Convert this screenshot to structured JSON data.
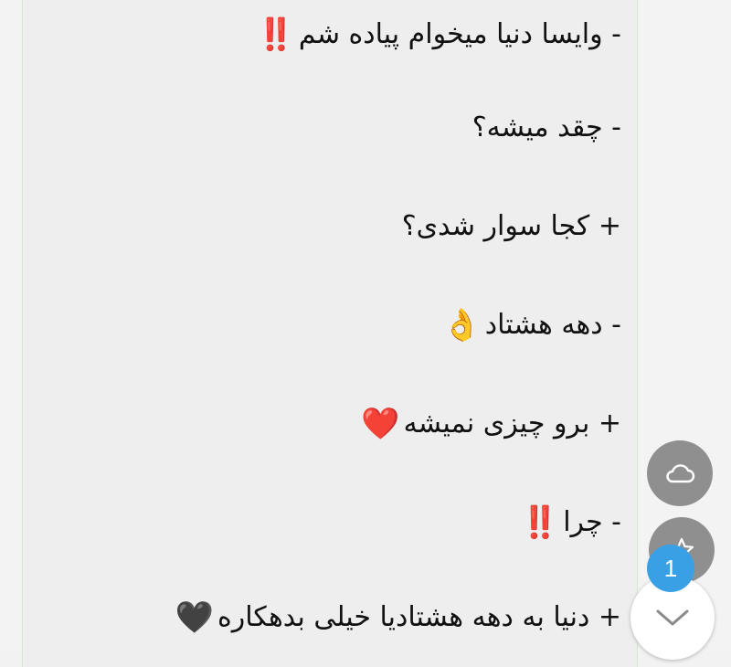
{
  "chat": {
    "messages": [
      {
        "text": "- وایسا دنیا میخوام پیاده شم",
        "emoji": "‼️"
      },
      {
        "text": "- چقد میشه؟",
        "emoji": ""
      },
      {
        "text": "+ کجا سوار شدی؟",
        "emoji": ""
      },
      {
        "text": "- دهه هشتاد",
        "emoji": "👌"
      },
      {
        "text": "+ برو چیزی نمیشه",
        "emoji": "❤️"
      },
      {
        "text": "- چرا",
        "emoji": "‼️"
      },
      {
        "text": "+ دنیا به دهه هشتادیا خیلی بدهکاره",
        "emoji": "🖤"
      }
    ]
  },
  "controls": {
    "unread_count": "1",
    "icons": {
      "cloud": "cloud-icon",
      "star": "star-icon",
      "chevron": "chevron-down-icon"
    }
  },
  "colors": {
    "bubble_bg": "#eeeeee",
    "fab_gray": "#8f8f8f",
    "badge_blue": "#3aa0e6"
  }
}
